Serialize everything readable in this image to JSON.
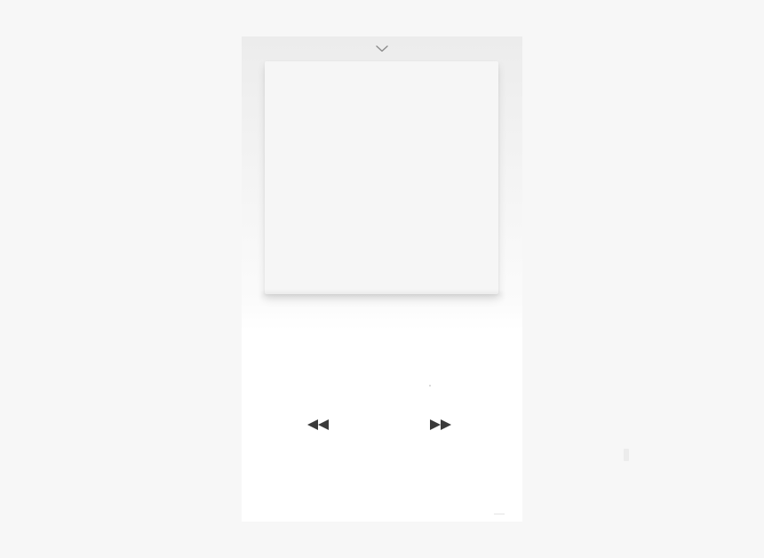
{
  "player": {
    "track_title": "",
    "track_artist": ""
  },
  "icons": {
    "collapse": "chevron-down-icon",
    "rewind": "rewind-icon",
    "play": "play-icon",
    "fast_forward": "fast-forward-icon"
  },
  "colors": {
    "background": "#f7f7f7",
    "sheet": "#ffffff",
    "artwork_placeholder": "#f6f6f6",
    "controls": "#3a3a3a",
    "chevron": "#8a8a8a"
  }
}
